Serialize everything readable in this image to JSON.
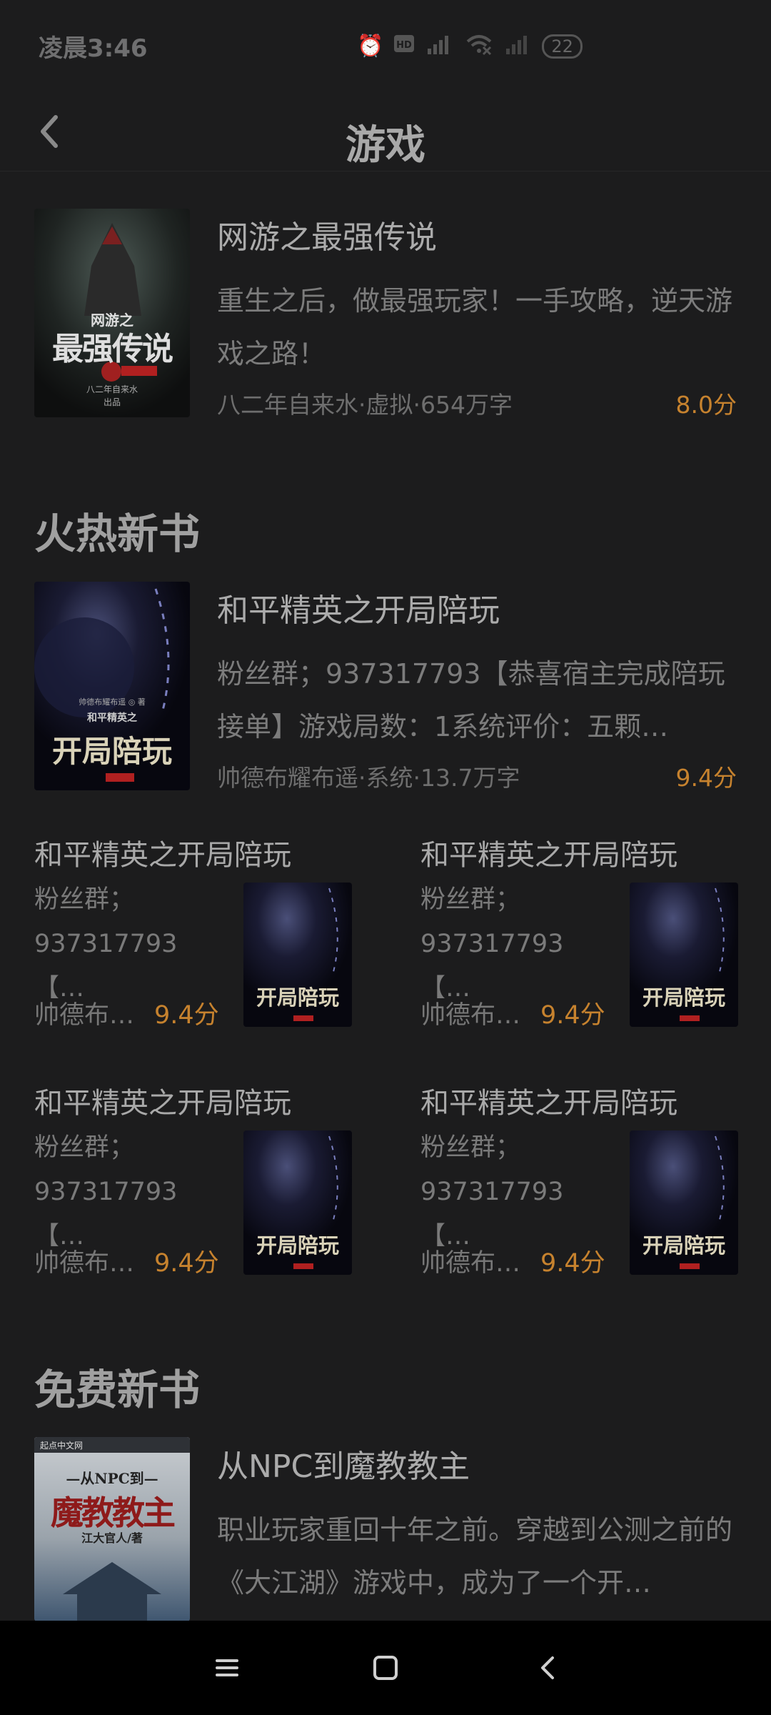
{
  "status": {
    "time": "凌晨3:46",
    "battery": "22",
    "icons": [
      "alarm-icon",
      "hd-icon",
      "signal-4g-icon",
      "wifi-off-icon",
      "signal-icon",
      "battery-icon"
    ]
  },
  "header": {
    "title": "游戏",
    "back_icon": "chevron-left-icon"
  },
  "featured": {
    "title": "网游之最强传说",
    "desc": "重生之后，做最强玩家！一手攻略，逆天游戏之路！",
    "meta": "八二年自来水·虚拟·654万字",
    "score": "8.0分",
    "cover": {
      "line1": "网游之",
      "line2": "最强传说",
      "publisher": "八二年自来水",
      "sub": "出品"
    }
  },
  "hot_section": {
    "title": "火热新书",
    "main": {
      "title": "和平精英之开局陪玩",
      "desc": "粉丝群；937317793【恭喜宿主完成陪玩接单】游戏局数：1系统评价：五颗…",
      "meta": "帅德布耀布遥·系统·13.7万字",
      "score": "9.4分",
      "cover": {
        "author": "帅德布耀布遥 ◎ 著",
        "line1": "和平精英之",
        "line2": "开局陪玩"
      }
    },
    "grid": [
      {
        "title": "和平精英之开局陪玩",
        "desc_line1": "粉丝群；",
        "desc_line2": "937317793【…",
        "author": "帅德布…",
        "score": "9.4分",
        "cover_text": "开局陪玩"
      },
      {
        "title": "和平精英之开局陪玩",
        "desc_line1": "粉丝群；",
        "desc_line2": "937317793【…",
        "author": "帅德布…",
        "score": "9.4分",
        "cover_text": "开局陪玩"
      },
      {
        "title": "和平精英之开局陪玩",
        "desc_line1": "粉丝群；",
        "desc_line2": "937317793【…",
        "author": "帅德布…",
        "score": "9.4分",
        "cover_text": "开局陪玩"
      },
      {
        "title": "和平精英之开局陪玩",
        "desc_line1": "粉丝群；",
        "desc_line2": "937317793【…",
        "author": "帅德布…",
        "score": "9.4分",
        "cover_text": "开局陪玩"
      }
    ]
  },
  "free_section": {
    "title": "免费新书",
    "main": {
      "title": "从NPC到魔教教主",
      "desc": "职业玩家重回十年之前。穿越到公测之前的《大江湖》游戏中，成为了一个开…",
      "cover": {
        "site": "起点中文网",
        "line1": "—从NPC到—",
        "line2": "魔教教主",
        "author": "江大官人/著"
      }
    }
  },
  "nav": {
    "menu_icon": "menu-icon",
    "home_icon": "home-square-icon",
    "back_icon": "back-triangle-icon"
  },
  "colors": {
    "background": "#1c1c1d",
    "score": "#c6822e",
    "nav_bar": "#000000"
  }
}
